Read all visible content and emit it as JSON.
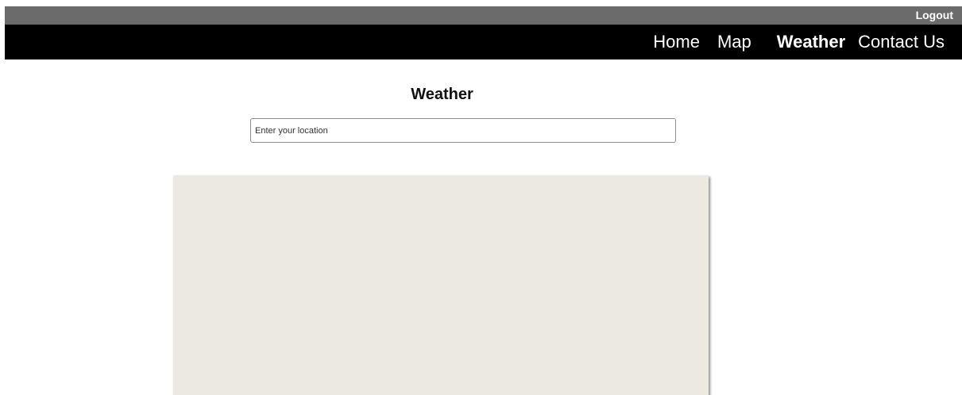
{
  "header": {
    "logout_label": "Logout",
    "nav": {
      "home": "Home",
      "map": "Map",
      "weather": "Weather",
      "contact": "Contact Us"
    }
  },
  "main": {
    "title": "Weather",
    "search": {
      "value": "",
      "placeholder": "Enter your location"
    }
  },
  "colors": {
    "top_strip": "#6b6b6b",
    "nav_bar": "#000000",
    "map_background": "#ece8e2"
  }
}
